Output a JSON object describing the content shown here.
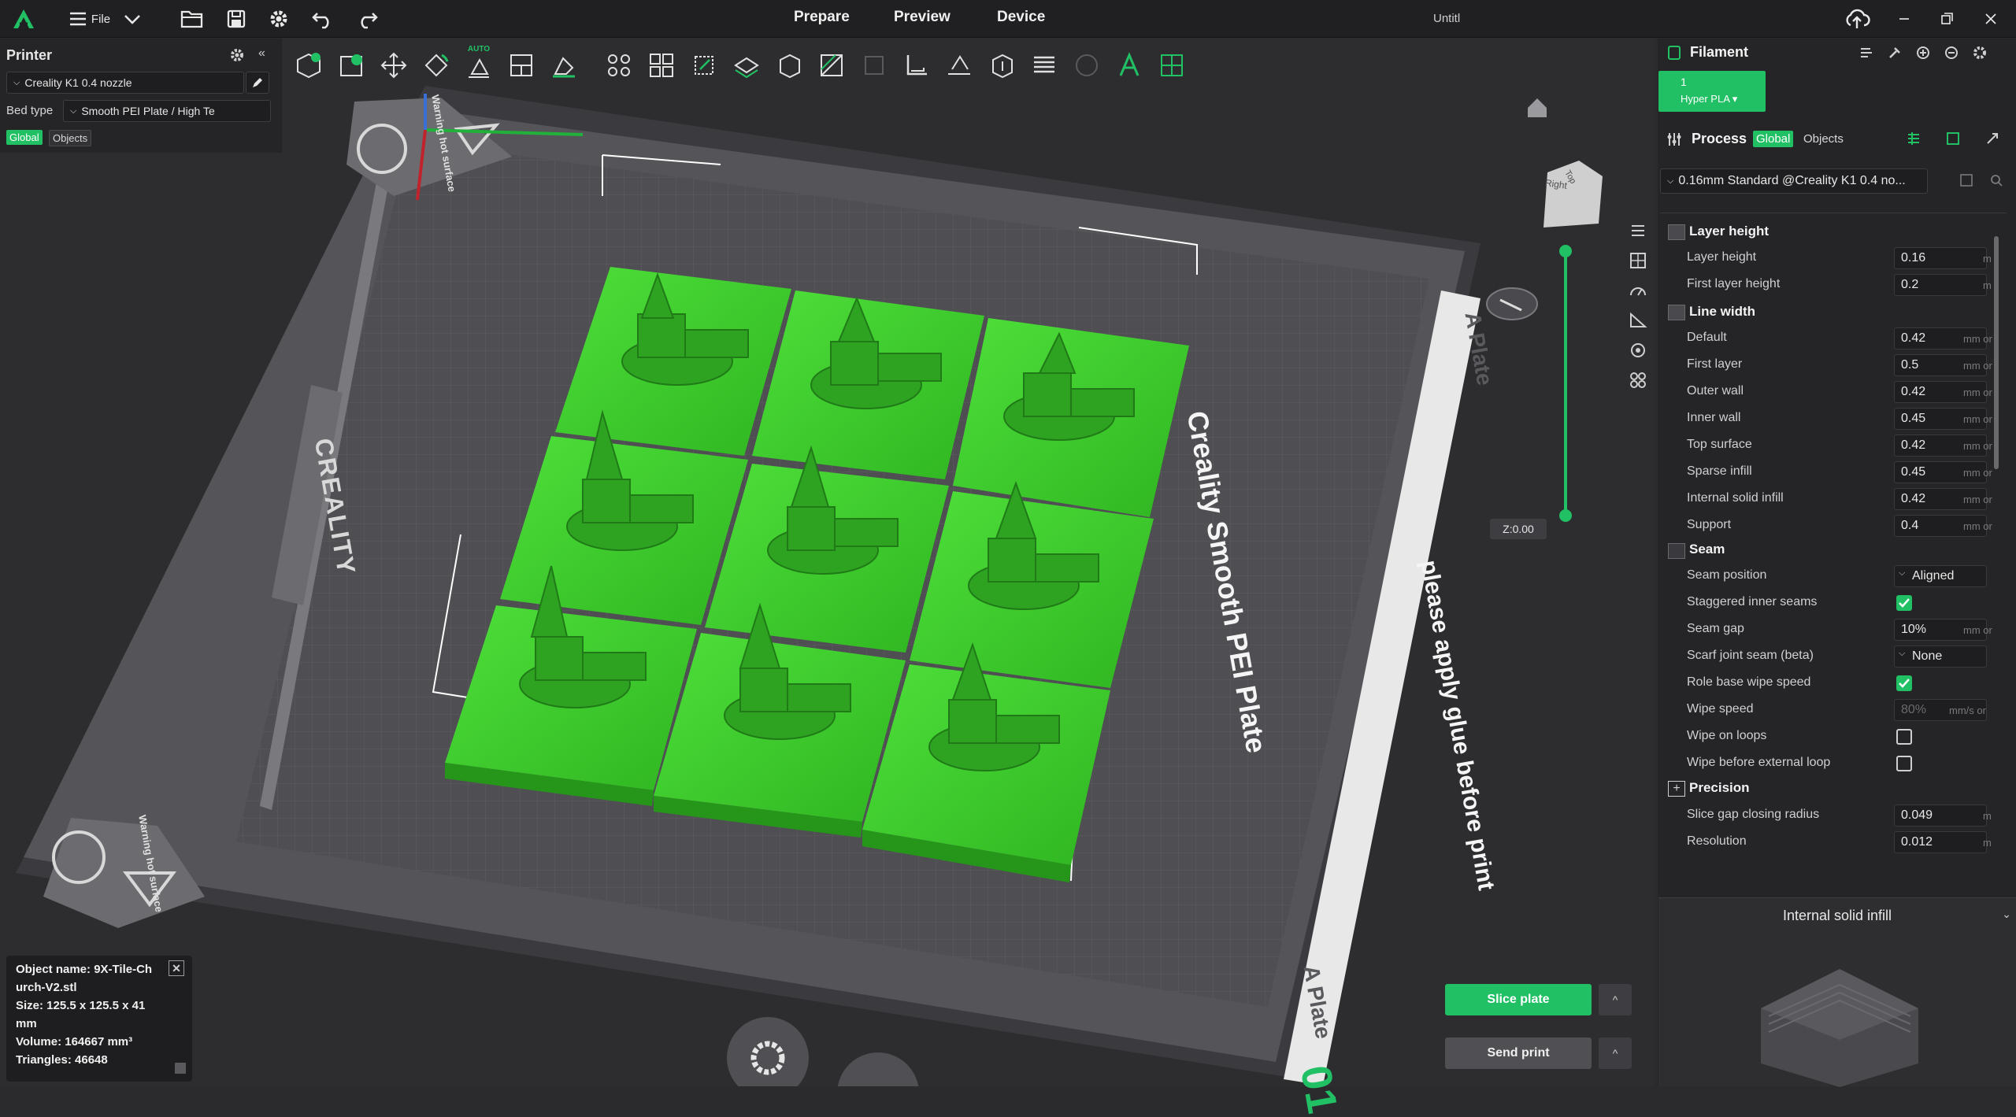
{
  "titlebar": {
    "file_label": "File",
    "tabs": [
      "Prepare",
      "Preview",
      "Device"
    ],
    "window_title": "Untitl"
  },
  "printer": {
    "title": "Printer",
    "printer_name": "Creality K1 0.4 nozzle",
    "bed_type_label": "Bed type",
    "bed_type_value": "Smooth PEI Plate / High Te",
    "global_label": "Global",
    "objects_label": "Objects"
  },
  "viewport": {
    "plate_name_text": "Creality Smooth PEI Plate",
    "glue_text": "please apply glue before print",
    "plate_label_top": "A Plate",
    "plate_label_bottom": "A Plate",
    "warning_text": "Warning hot surface",
    "brand_text": "CREALITY",
    "view_cube_top": "Top",
    "view_cube_right": "Right",
    "z_readout": "Z:0.00",
    "plate_number": "01",
    "auto_label": "AUTO"
  },
  "object_info": {
    "name_line1": "Object name: 9X-Tile-Ch",
    "name_line2": "urch-V2.stl",
    "size_line1": "Size: 125.5 x 125.5 x 41",
    "size_line2": "mm",
    "volume": "Volume: 164667 mm³",
    "triangles": "Triangles: 46648"
  },
  "filament": {
    "title": "Filament",
    "slot_number": "1",
    "slot_name": "Hyper PLA ▾",
    "slot_color": "#21c064"
  },
  "process": {
    "title": "Process",
    "global_label": "Global",
    "objects_label": "Objects",
    "preset": "0.16mm Standard @Creality K1 0.4 no...",
    "groups": [
      {
        "name": "Layer height",
        "params": [
          {
            "label": "Layer height",
            "value": "0.16",
            "unit": "m"
          },
          {
            "label": "First layer height",
            "value": "0.2",
            "unit": "m"
          }
        ]
      },
      {
        "name": "Line width",
        "params": [
          {
            "label": "Default",
            "value": "0.42",
            "unit": "mm or"
          },
          {
            "label": "First layer",
            "value": "0.5",
            "unit": "mm or"
          },
          {
            "label": "Outer wall",
            "value": "0.42",
            "unit": "mm or"
          },
          {
            "label": "Inner wall",
            "value": "0.45",
            "unit": "mm or"
          },
          {
            "label": "Top surface",
            "value": "0.42",
            "unit": "mm or"
          },
          {
            "label": "Sparse infill",
            "value": "0.45",
            "unit": "mm or"
          },
          {
            "label": "Internal solid infill",
            "value": "0.42",
            "unit": "mm or"
          },
          {
            "label": "Support",
            "value": "0.4",
            "unit": "mm or"
          }
        ]
      },
      {
        "name": "Seam",
        "params": [
          {
            "label": "Seam position",
            "value": "Aligned",
            "kind": "select"
          },
          {
            "label": "Staggered inner seams",
            "kind": "check",
            "checked": true
          },
          {
            "label": "Seam gap",
            "value": "10%",
            "unit": "mm or"
          },
          {
            "label": "Scarf joint seam (beta)",
            "value": "None",
            "kind": "select"
          },
          {
            "label": "Role base wipe speed",
            "kind": "check",
            "checked": true
          },
          {
            "label": "Wipe speed",
            "value": "80%",
            "unit": "mm/s or",
            "disabled": true
          },
          {
            "label": "Wipe on loops",
            "kind": "check",
            "checked": false
          },
          {
            "label": "Wipe before external loop",
            "kind": "check",
            "checked": false
          }
        ]
      },
      {
        "name": "Precision",
        "params": [
          {
            "label": "Slice gap closing radius",
            "value": "0.049",
            "unit": "m"
          },
          {
            "label": "Resolution",
            "value": "0.012",
            "unit": "m"
          }
        ]
      }
    ]
  },
  "preview_panel": {
    "title": "Internal solid infill"
  },
  "actions": {
    "slice_label": "Slice plate",
    "send_label": "Send print"
  },
  "colors": {
    "accent": "#21c064",
    "model": "#3fd62e"
  }
}
